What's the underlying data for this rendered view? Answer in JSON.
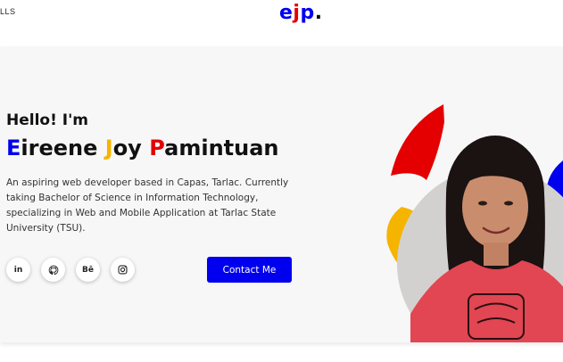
{
  "nav": {
    "fragment": "LLS"
  },
  "logo": {
    "e": "e",
    "j": "j",
    "p": "p",
    "dot": "."
  },
  "hero": {
    "greeting": "Hello! I'm",
    "name": [
      {
        "initial": "E",
        "rest": "ireene"
      },
      {
        "initial": "J",
        "rest": "oy"
      },
      {
        "initial": "P",
        "rest": "amintuan"
      }
    ],
    "bio": "An aspiring web developer based in Capas, Tarlac. Currently taking Bachelor of Science in Information Technology, specializing in Web and Mobile Application at Tarlac State University (TSU).",
    "contact_label": "Contact Me",
    "social": [
      {
        "name": "linkedin-icon",
        "glyph": "in"
      },
      {
        "name": "github-icon",
        "glyph": ""
      },
      {
        "name": "behance-icon",
        "glyph": "Bē"
      },
      {
        "name": "instagram-icon",
        "glyph": ""
      }
    ]
  },
  "colors": {
    "blue": "#0000ee",
    "yellow": "#f5b400",
    "red": "#e40000",
    "hero_bg": "#f7f7f7",
    "text": "#111111"
  }
}
